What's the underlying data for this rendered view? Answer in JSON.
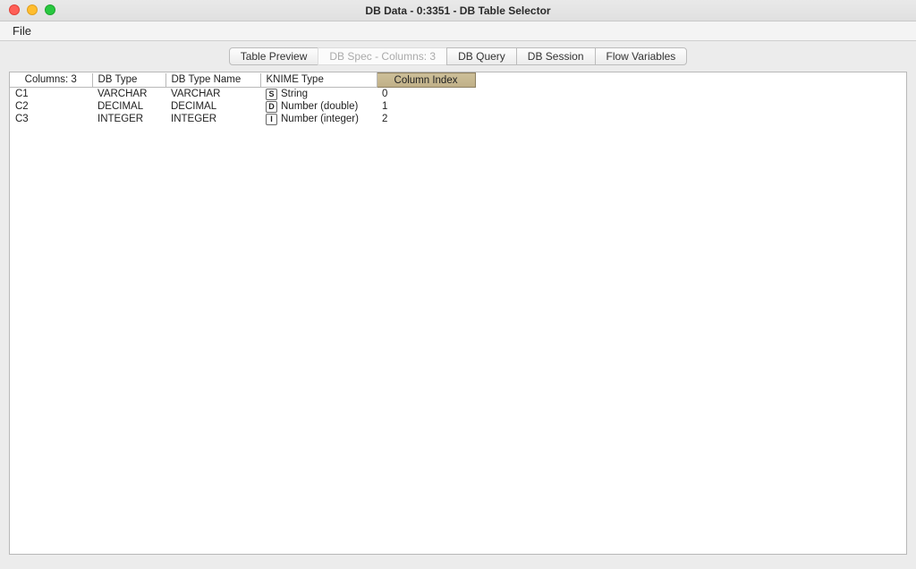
{
  "window": {
    "title": "DB Data - 0:3351 - DB Table Selector"
  },
  "menu": {
    "file": "File"
  },
  "tabs": {
    "table_preview": "Table Preview",
    "db_spec": "DB Spec - Columns: 3",
    "db_query": "DB Query",
    "db_session": "DB Session",
    "flow_variables": "Flow Variables",
    "active": "db_spec"
  },
  "table": {
    "headers": {
      "row": "Columns: 3",
      "db_type": "DB Type",
      "db_type_name": "DB Type Name",
      "knime_type": "KNIME Type",
      "column_index": "Column Index"
    },
    "rows": [
      {
        "name": "C1",
        "db_type": "VARCHAR",
        "db_type_name": "VARCHAR",
        "knime_icon": "S",
        "knime_type": "String",
        "index": "0"
      },
      {
        "name": "C2",
        "db_type": "DECIMAL",
        "db_type_name": "DECIMAL",
        "knime_icon": "D",
        "knime_type": "Number (double)",
        "index": "1"
      },
      {
        "name": "C3",
        "db_type": "INTEGER",
        "db_type_name": "INTEGER",
        "knime_icon": "I",
        "knime_type": "Number (integer)",
        "index": "2"
      }
    ],
    "selected_header": "column_index"
  }
}
